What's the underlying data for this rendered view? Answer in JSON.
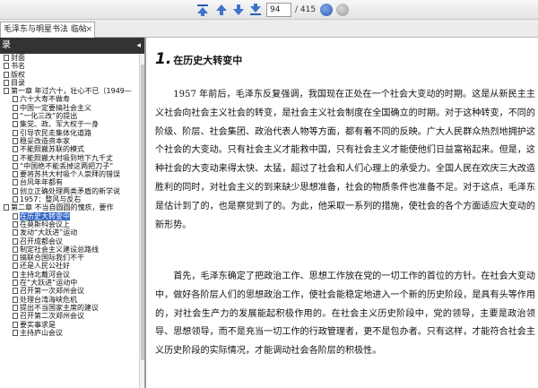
{
  "toolbar": {
    "page_current": "94",
    "page_total": "/ 415",
    "icons": [
      "first-page-icon",
      "previous-page-icon",
      "next-page-icon",
      "last-page-icon",
      "go-back-icon",
      "go-forward-icon"
    ]
  },
  "tab": {
    "title": "毛泽东与明星书法 临帖",
    "close": "×"
  },
  "sidebar": {
    "title": "录",
    "collapse": "◂",
    "items": [
      {
        "label": "封面",
        "level": 0
      },
      {
        "label": "书名",
        "level": 0
      },
      {
        "label": "版权",
        "level": 0
      },
      {
        "label": "目录",
        "level": 0
      },
      {
        "label": "第一章  年过六十，壮心不已（1949—",
        "level": 0
      },
      {
        "label": "六十大寿不做寿",
        "level": 1
      },
      {
        "label": "中国一定要搞社会主义",
        "level": 1
      },
      {
        "label": "“一化三改”的提出",
        "level": 1
      },
      {
        "label": "集党、政、军大权于一身",
        "level": 1
      },
      {
        "label": "引导农民走集体化道路",
        "level": 1
      },
      {
        "label": "稳妥改造资本家",
        "level": 1
      },
      {
        "label": "不能照搬苏联的模式",
        "level": 1
      },
      {
        "label": "不能照搬大村吸到地下九千丈",
        "level": 1
      },
      {
        "label": "“中国绝不能丢掉这两把刀子”",
        "level": 1
      },
      {
        "label": "要将苏共大村吸个人崇拜的错误",
        "level": 1
      },
      {
        "label": "台风年年都有",
        "level": 1
      },
      {
        "label": "创立正确处理两类矛盾的新学说",
        "level": 1
      },
      {
        "label": "1957：整风与反右",
        "level": 1
      },
      {
        "label": "第二章  不当自圆圆的愧疚，要作",
        "level": 0
      },
      {
        "label": "在历史大转变中",
        "level": 1,
        "selected": true
      },
      {
        "label": "在莫斯科会议上",
        "level": 1
      },
      {
        "label": "发动“大跃进”运动",
        "level": 1
      },
      {
        "label": "召开成都会议",
        "level": 1
      },
      {
        "label": "制定社会主义建设总路线",
        "level": 1
      },
      {
        "label": "搞联合国际我们不干",
        "level": 1
      },
      {
        "label": "还是人民公社好",
        "level": 1
      },
      {
        "label": "主持北戴河会议",
        "level": 1
      },
      {
        "label": "在“大跃进”运动中",
        "level": 1
      },
      {
        "label": "召开第一次郑州会议",
        "level": 1
      },
      {
        "label": "处理台湾海峡危机",
        "level": 1
      },
      {
        "label": "提出不当国家主席的建议",
        "level": 1
      },
      {
        "label": "召开第二次郑州会议",
        "level": 1
      },
      {
        "label": "要实事求是",
        "level": 1
      },
      {
        "label": "主持庐山会议",
        "level": 1
      }
    ]
  },
  "document": {
    "chapter_number": "1.",
    "chapter_title": "在历史大转变中",
    "paragraphs": [
      "1957 年前后，毛泽东反复强调，我国现在正处在一个社会大变动的时期。这是从新民主主义社会向社会主义社会的转变，是社会主义社会制度在全国确立的时期。对于这种转变，不同的阶级、阶层、社会集团、政治代表人物等方面，都有着不同的反映。广大人民群众热烈地拥护这个社会的大变动。只有社会主义才能救中国，只有社会主义才能使他们日益富裕起来。但是，这种社会的大变动来得太快、太猛，超过了社会和人们心理上的承受力。全国人民在欢庆三大改造胜利的同时，对社会主义的到来缺少思想准备，社会的物质条件也准备不足。对于这点，毛泽东是估计到了的，也是察觉到了的。为此，他采取一系列的措施，使社会的各个方面适应大变动的新形势。",
      "首先，毛泽东确定了把政治工作、思想工作放在党的一切工作的首位的方针。在社会大变动中，做好各阶层人们的思想政治工作，使社会能稳定地进入一个新的历史阶段，是具有头等作用的，对社会生产力的发展能起积极作用的。在社会主义历史阶段中，党的领导，主要是政治领导、思想领导，而不是充当一切工作的行政管理者，更不是包办者。只有这样，才能符合社会主义历史阶段的实际情况，才能调动社会各阶层的积极性。"
    ]
  }
}
